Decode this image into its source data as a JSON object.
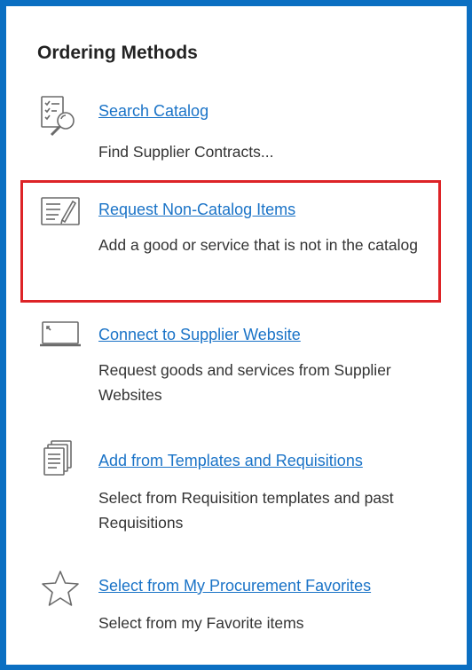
{
  "panel": {
    "title": "Ordering Methods",
    "accent_color": "#0b6fc2",
    "highlight_color": "#dd2327"
  },
  "methods": [
    {
      "link": "Search Catalog",
      "description": "Find Supplier Contracts...",
      "icon": "search-catalog-icon"
    },
    {
      "link": "Request Non-Catalog Items",
      "description": "Add a good or service that is not in the catalog",
      "icon": "edit-form-icon"
    },
    {
      "link": "Connect to Supplier Website",
      "description": "Request goods and services from Supplier Websites",
      "icon": "laptop-icon"
    },
    {
      "link": "Add from Templates and Requisitions",
      "description": "Select from Requisition templates and past Requisitions",
      "icon": "documents-stack-icon"
    },
    {
      "link": "Select from My Procurement Favorites",
      "description": "Select from my Favorite items",
      "icon": "star-icon"
    }
  ]
}
